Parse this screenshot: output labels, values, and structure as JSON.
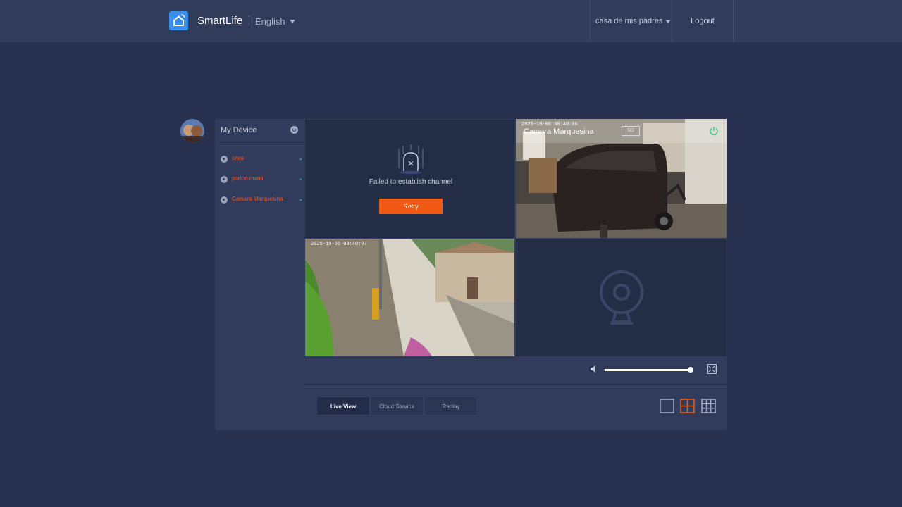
{
  "header": {
    "brand": "SmartLife",
    "language": "English",
    "account": "casa de mis padres",
    "logout": "Logout"
  },
  "sidebar": {
    "title": "My Device",
    "devices": [
      {
        "label": "casa"
      },
      {
        "label": "porton mami"
      },
      {
        "label": "Camara Marquesina"
      }
    ]
  },
  "grid": {
    "cell1": {
      "error": "Failed to establish channel",
      "retry": "Retry"
    },
    "cell2": {
      "name": "Camara Marquesina",
      "badge": "SD",
      "timestamp": "2025-10-06 08:40:06"
    },
    "cell3": {
      "timestamp": "2025-10-06 08:40:07"
    }
  },
  "controls": {
    "volume": 0.95
  },
  "tabs": [
    {
      "label": "Live View",
      "active": true
    },
    {
      "label": "Cloud Service",
      "active": false
    },
    {
      "label": "Replay",
      "active": false
    }
  ],
  "colors": {
    "accent": "#f05a12",
    "brand_blue": "#3a8de8",
    "online": "#2fd38a",
    "background": "#283250"
  }
}
